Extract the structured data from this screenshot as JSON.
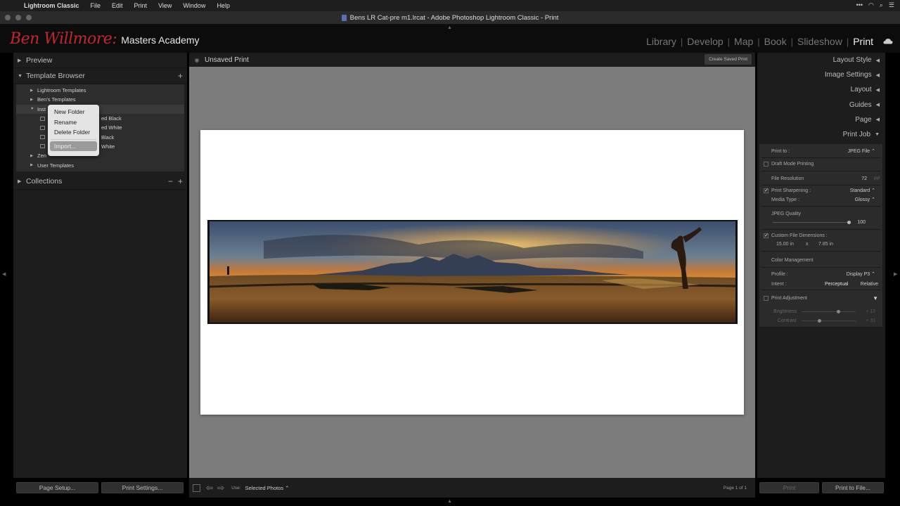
{
  "menubar": {
    "app_name": "Lightroom Classic",
    "items": [
      "File",
      "Edit",
      "Print",
      "View",
      "Window",
      "Help"
    ]
  },
  "window": {
    "title": "Bens LR Cat-pre m1.lrcat - Adobe Photoshop Lightroom Classic - Print"
  },
  "identity": {
    "script": "Ben Willmore:",
    "academy": "Masters Academy"
  },
  "modules": [
    "Library",
    "Develop",
    "Map",
    "Book",
    "Slideshow",
    "Print"
  ],
  "active_module": "Print",
  "left_panel": {
    "preview": "Preview",
    "template_browser": "Template Browser",
    "template_add": "+",
    "tree": {
      "lightroom_templates": "Lightroom Templates",
      "bens_templates": "Ben's Templates",
      "inst_partial": "Inst",
      "child_1": "ed Black",
      "child_2": "ed White",
      "child_3": "Black",
      "child_4": "White",
      "zen_partial": "Zen",
      "user_templates": "User Templates"
    },
    "collections": "Collections",
    "collections_minus": "−",
    "collections_plus": "+"
  },
  "context_menu": {
    "new_folder": "New Folder",
    "rename": "Rename",
    "delete_folder": "Delete Folder",
    "import": "Import..."
  },
  "left_footer": {
    "page_setup": "Page Setup...",
    "print_settings": "Print Settings..."
  },
  "center": {
    "toolbar_title": "Unsaved Print",
    "create_saved": "Create Saved Print",
    "use_label": "Use:",
    "use_value": "Selected Photos",
    "page_count": "Page 1 of 1"
  },
  "right_panel": {
    "headers": [
      "Layout Style",
      "Image Settings",
      "Layout",
      "Guides",
      "Page",
      "Print Job"
    ],
    "print_to_label": "Print to :",
    "print_to_value": "JPEG File",
    "draft_mode": "Draft Mode Printing",
    "file_resolution_label": "File Resolution",
    "file_resolution_value": "72",
    "file_resolution_unit": "ppi",
    "print_sharpening": "Print Sharpening :",
    "print_sharpening_value": "Standard",
    "media_type": "Media Type :",
    "media_type_value": "Glossy",
    "jpeg_quality": "JPEG Quality",
    "jpeg_quality_value": "100",
    "custom_dims": "Custom File Dimensions :",
    "dims_w": "15.00 in",
    "dims_x": "x",
    "dims_h": "7.85 in",
    "color_management": "Color Management",
    "profile_label": "Profile :",
    "profile_value": "Display P3",
    "intent_label": "Intent :",
    "intent_perceptual": "Perceptual",
    "intent_relative": "Relative",
    "print_adjustment": "Print Adjustment",
    "brightness": "Brightness",
    "brightness_value": "+ 13",
    "contrast": "Contrast",
    "contrast_value": "+ 31"
  },
  "right_footer": {
    "print": "Print",
    "print_to_file": "Print to File..."
  },
  "colors": {
    "brand_red": "#c0282d",
    "panel_bg": "#1d1d1d",
    "canvas_bg": "#7c7c7c"
  }
}
